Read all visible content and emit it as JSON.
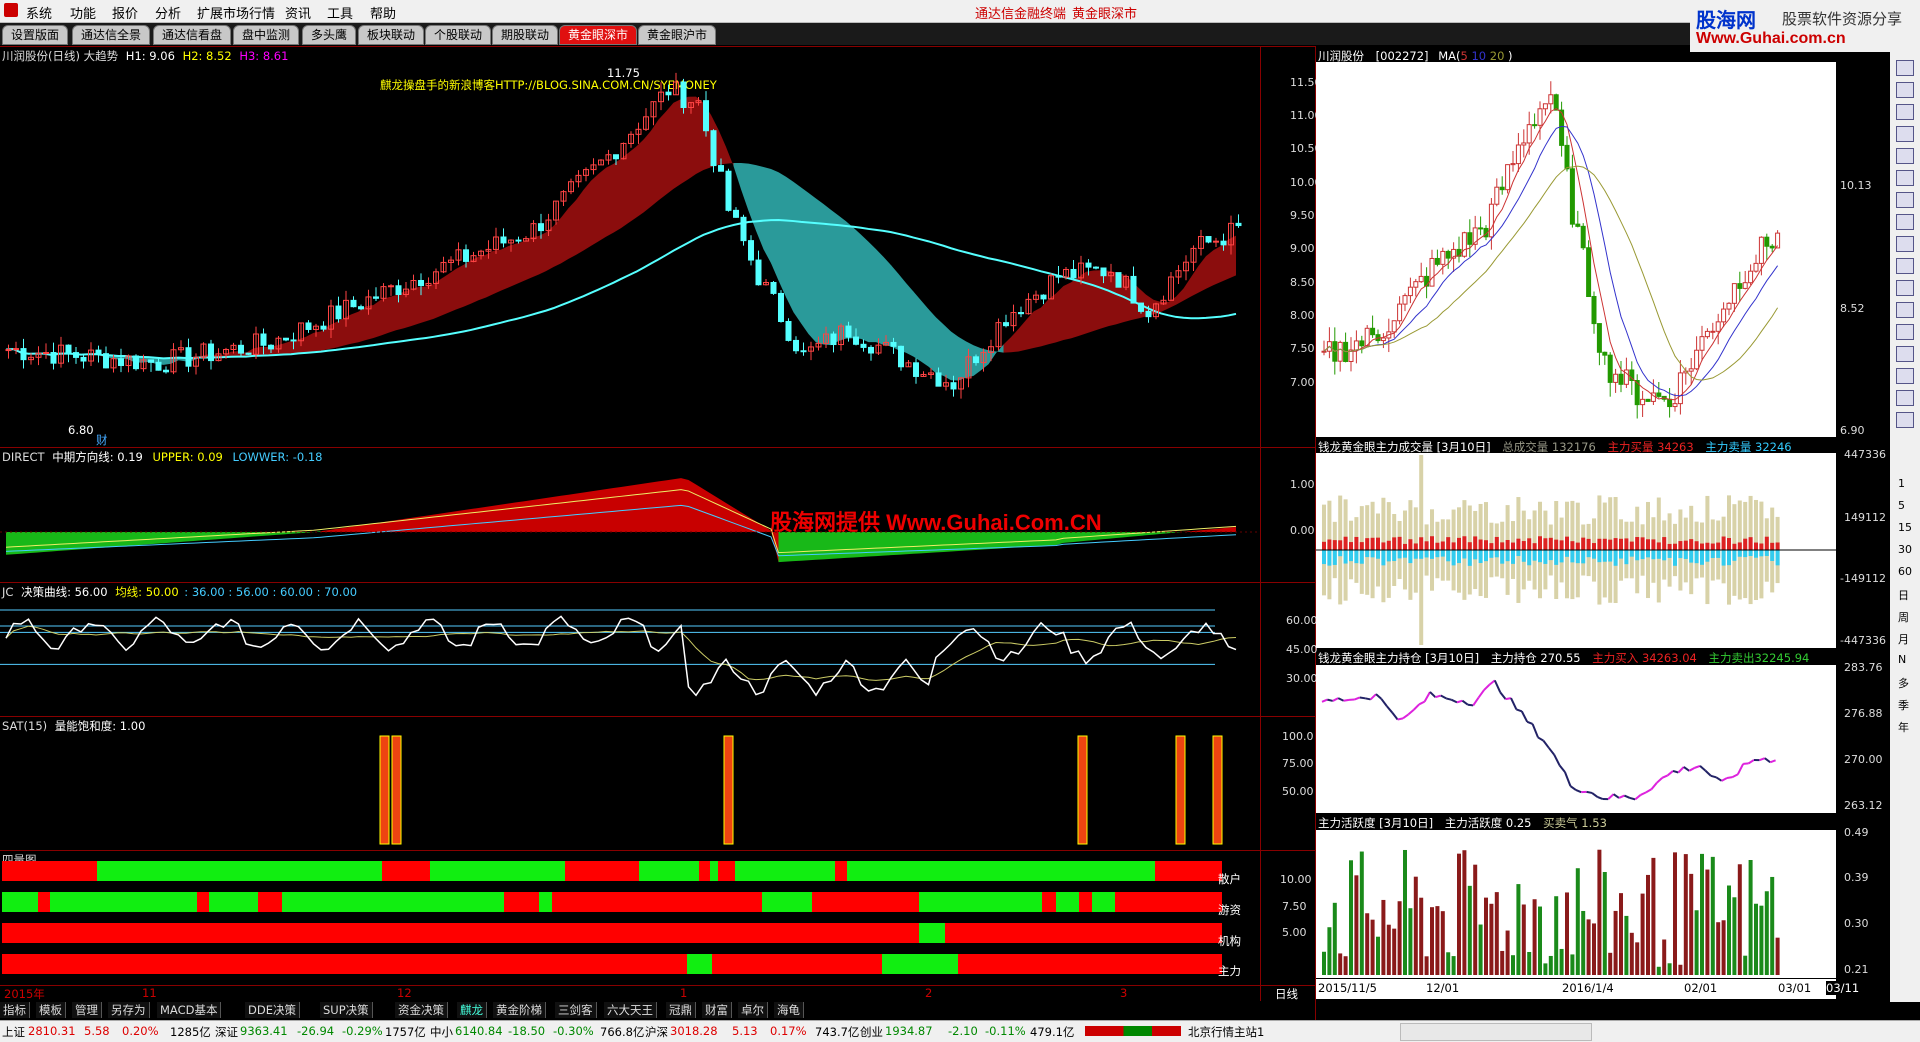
{
  "menu": {
    "items": [
      "系统",
      "功能",
      "报价",
      "分析",
      "扩展市场行情",
      "资讯",
      "工具",
      "帮助"
    ],
    "center_links": [
      "通达信金融终端",
      "黄金眼深市"
    ]
  },
  "brand": {
    "name": "股海网",
    "slogan": "股票软件资源分享",
    "url": "Www.Guhai.com.cn"
  },
  "tabs": [
    "设置版面",
    "通达信全景",
    "通达信看盘",
    "盘中监测",
    "多头鹰",
    "板块联动",
    "个股联动",
    "期股联动",
    "黄金眼深市",
    "黄金眼沪市"
  ],
  "active_tab": "黄金眼深市",
  "main": {
    "title": "川润股份(日线) 大趋势",
    "h1": "H1: 9.06",
    "h2": "H2: 8.52",
    "h3": "H3: 8.61",
    "blog": "麒龙操盘手的新浪博客HTTP://BLOG.SINA.COM.CN/SYEMONEY",
    "high_mark": "11.75",
    "low_mark": "6.80",
    "fin_mark": "财",
    "price_axis": [
      "11.50",
      "11.00",
      "10.50",
      "10.00",
      "9.50",
      "9.00",
      "8.50",
      "8.00",
      "7.50",
      "7.00"
    ],
    "x_dates": [
      "2015年",
      "11",
      "12",
      "1",
      "2",
      "3"
    ],
    "period": "日线",
    "watermark": "股海网提供 Www.Guhai.Com.CN"
  },
  "direct": {
    "name": "DIRECT",
    "line1": "中期方向线: 0.19",
    "upper": "UPPER: 0.09",
    "lower": "LOWWER: -0.18",
    "axis": [
      "1.00",
      "0.00"
    ]
  },
  "jc": {
    "name": "JC",
    "curve": "决策曲线: 56.00",
    "avg": "均线: 50.00",
    "levels": ": 36.00 : 56.00 : 60.00 : 70.00",
    "axis": [
      "60.00",
      "45.00",
      "30.00"
    ]
  },
  "sat": {
    "name": "SAT(15)",
    "label": "量能饱和度: 1.00",
    "axis": [
      "100.0",
      "75.00",
      "50.00"
    ]
  },
  "fourq": {
    "name": "四量图",
    "rows": [
      "散户",
      "游资",
      "机构",
      "主力"
    ],
    "axis": [
      "10.00",
      "7.50",
      "5.00"
    ]
  },
  "right": {
    "title": "川润股份",
    "code": "[002272]",
    "ma": "MA(",
    "ma_values": [
      "5",
      "10",
      "20"
    ],
    "ma_close": ")",
    "price_axis": [
      "10.13",
      "8.52",
      "6.90"
    ],
    "dates": [
      "2015/11/5",
      "12/01",
      "2016/1/4",
      "02/01",
      "03/01",
      "03/11"
    ],
    "vol": {
      "title": "钱龙黄金眼主力成交量 [3月10日]",
      "total": "总成交量 132176",
      "buy": "主力买量 34263",
      "sell": "主力卖量 32246",
      "axis": [
        "447336",
        "149112",
        "-149112",
        "-447336"
      ]
    },
    "hold": {
      "title": "钱龙黄金眼主力持仓 [3月10日]",
      "hold": "主力持仓 270.55",
      "buy": "主力买入 34263.04",
      "sell": "主力卖出32245.94",
      "axis": [
        "283.76",
        "276.88",
        "270.00",
        "263.12"
      ]
    },
    "act": {
      "title": "主力活跃度 [3月10日]",
      "val": "主力活跃度 0.25",
      "mood": "买卖气 1.53",
      "axis": [
        "0.49",
        "0.39",
        "0.30",
        "0.21"
      ]
    }
  },
  "bottom_tabs": [
    "指标",
    "模板",
    "管理",
    "另存为",
    "MACD基本",
    "DDE决策",
    "SUP决策",
    "资金决策",
    "麒龙",
    "黄金阶梯",
    "三剑客",
    "六大天王",
    "冠鼎",
    "财富",
    "卓尔",
    "海龟"
  ],
  "status": {
    "sh": "上证",
    "sh_v": "2810.31",
    "sh_c": "5.58",
    "sh_p": "0.20%",
    "sh_a": "1285亿",
    "sz": "深证",
    "sz_v": "9363.41",
    "sz_c": "-26.94",
    "sz_p": "-0.29%",
    "sz_a": "1757亿",
    "zx": "中小",
    "zx_v": "6140.84",
    "zx_c": "-18.50",
    "zx_p": "-0.30%",
    "zx_a": "766.8亿",
    "hs": "沪深",
    "hs_v": "3018.28",
    "hs_c": "5.13",
    "hs_p": "0.17%",
    "hs_a": "743.7亿",
    "cy": "创业",
    "cy_v": "1934.87",
    "cy_c": "-2.10",
    "cy_p": "-0.11%",
    "cy_a": "479.1亿",
    "host": "北京行情主站1"
  },
  "right_tool": [
    "1",
    "5",
    "15",
    "30",
    "60",
    "日",
    "周",
    "月",
    "N",
    "多",
    "季",
    "年"
  ]
}
